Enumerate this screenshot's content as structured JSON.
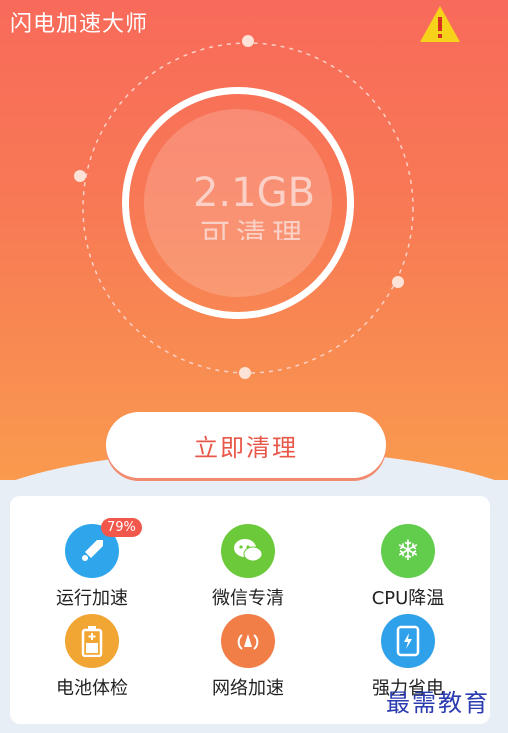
{
  "header": {
    "title": "闪电加速大师",
    "warning_icon": "warning-icon"
  },
  "meter": {
    "value": "2.1GB",
    "label": "可清理"
  },
  "action": {
    "clean_label": "立即清理"
  },
  "tools": [
    {
      "label": "运行加速",
      "icon": "rocket-icon",
      "color": "#2fa6ec",
      "badge": "79%"
    },
    {
      "label": "微信专清",
      "icon": "wechat-icon",
      "color": "#6cca3a"
    },
    {
      "label": "CPU降温",
      "icon": "snowflake-icon",
      "color": "#62cc4c"
    },
    {
      "label": "电池体检",
      "icon": "battery-icon",
      "color": "#f1a533"
    },
    {
      "label": "网络加速",
      "icon": "network-icon",
      "color": "#f27e47"
    },
    {
      "label": "强力省电",
      "icon": "power-save-icon",
      "color": "#2fa0ea"
    }
  ],
  "watermark": "最需教育",
  "colors": {
    "primary": "#f86a5a",
    "accent": "#e8584a"
  }
}
